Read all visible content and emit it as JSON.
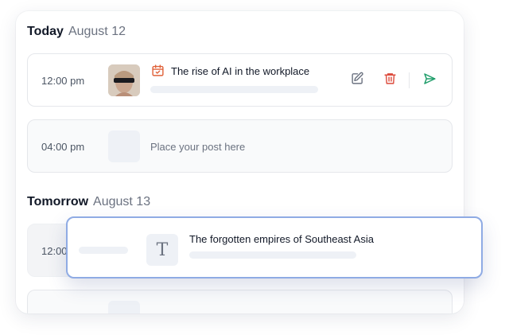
{
  "today": {
    "day": "Today",
    "date": "August 12"
  },
  "tomorrow": {
    "day": "Tomorrow",
    "date": "August 13"
  },
  "slots": [
    {
      "time": "12:00 pm",
      "title": "The rise of AI in the workplace"
    },
    {
      "time": "04:00 pm",
      "placeholder": "Place your post here"
    },
    {
      "time": "12:00"
    }
  ],
  "drag_card": {
    "title": "The forgotten empires of Southeast Asia",
    "type_glyph": "T"
  },
  "icons": {
    "calendar": "calendar-icon",
    "edit": "edit-icon",
    "delete": "trash-icon",
    "send": "send-icon"
  },
  "colors": {
    "calendar_accent": "#e0623a",
    "delete": "#dc4a3b",
    "send": "#1f9d6a",
    "drag_border": "#8fabe4"
  }
}
